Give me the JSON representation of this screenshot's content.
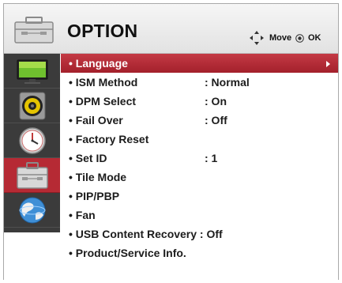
{
  "header": {
    "title": "OPTION",
    "icon": "toolbox-icon",
    "hints": [
      {
        "icon": "move-arrows-icon",
        "label": "Move"
      },
      {
        "icon": "ok-button-icon",
        "label": "OK"
      }
    ]
  },
  "sidebar": {
    "items": [
      {
        "icon": "monitor-picture-icon",
        "active": false
      },
      {
        "icon": "speaker-audio-icon",
        "active": false
      },
      {
        "icon": "clock-time-icon",
        "active": false
      },
      {
        "icon": "toolbox-option-icon",
        "active": true
      },
      {
        "icon": "globe-network-icon",
        "active": false
      }
    ]
  },
  "menu": {
    "items": [
      {
        "label": "• Language",
        "value": "",
        "selected": true,
        "submenu": true
      },
      {
        "label": "• ISM Method",
        "value": ": Normal"
      },
      {
        "label": "• DPM Select",
        "value": ": On"
      },
      {
        "label": "• Fail Over",
        "value": ": Off"
      },
      {
        "label": "• Factory Reset",
        "value": ""
      },
      {
        "label": "• Set ID",
        "value": ": 1"
      },
      {
        "label": "• Tile Mode",
        "value": ""
      },
      {
        "label": "• PIP/PBP",
        "value": ""
      },
      {
        "label": "• Fan",
        "value": ""
      },
      {
        "label": "• USB Content Recovery : Off",
        "value": ""
      },
      {
        "label": "• Product/Service Info.",
        "value": ""
      }
    ]
  },
  "colors": {
    "selected": "#b62a34",
    "sidebar": "#3b3b3b",
    "header": "#e9e9e9"
  }
}
